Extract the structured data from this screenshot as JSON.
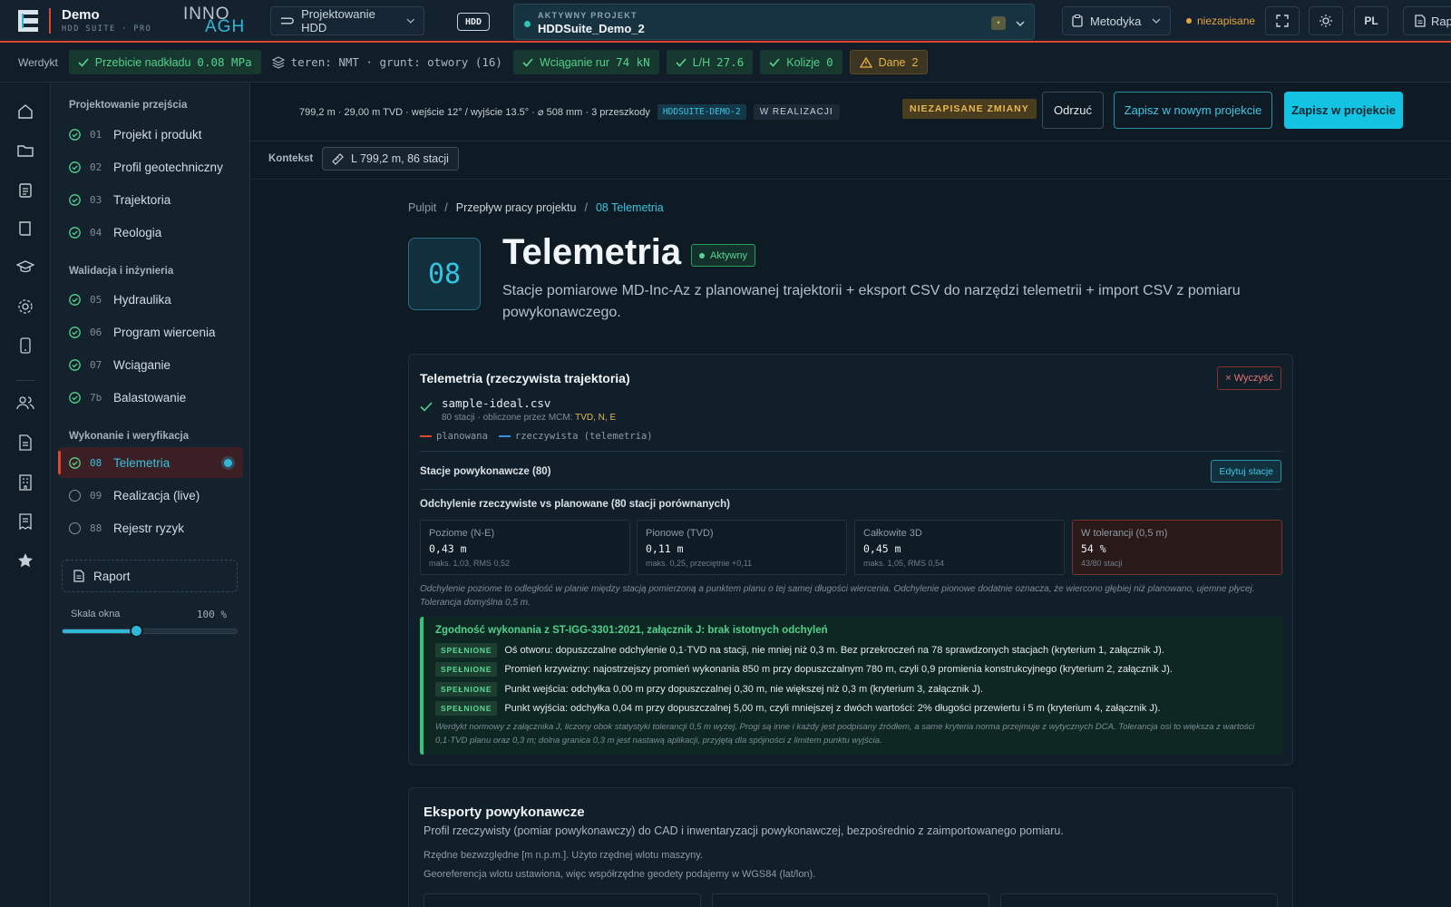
{
  "app": {
    "name": "Demo",
    "subtitle": "HDD SUITE · PRO",
    "partner_logo_text": "INNO AGH",
    "module_selector": "Projektowanie HDD",
    "mode_badge": "HDD",
    "active_project_label": "AKTYWNY PROJEKT",
    "active_project_name": "HDDSuite_Demo_2",
    "methodology": "Metodyka",
    "unsaved_indicator": "niezapisane",
    "language": "PL",
    "report_button_partial": "Rap"
  },
  "verdict": {
    "label": "Werdykt",
    "chips": [
      {
        "status": "ok",
        "text": "Przebicie nadkładu",
        "value": "0.08 MPa"
      },
      {
        "status": "info",
        "text": "teren: NMT · grunt: otwory (16)"
      },
      {
        "status": "ok",
        "text": "Wciąganie rur",
        "value": "74 kN"
      },
      {
        "status": "ok",
        "text": "L/H",
        "value": "27.6"
      },
      {
        "status": "ok",
        "text": "Kolizje",
        "value": "0"
      },
      {
        "status": "warn",
        "text": "Dane",
        "value": "2"
      }
    ]
  },
  "sidebar": {
    "sections": [
      {
        "title": "Projektowanie przejścia",
        "items": [
          {
            "num": "01",
            "label": "Projekt i produkt",
            "state": "done"
          },
          {
            "num": "02",
            "label": "Profil geotechniczny",
            "state": "done"
          },
          {
            "num": "03",
            "label": "Trajektoria",
            "state": "done"
          },
          {
            "num": "04",
            "label": "Reologia",
            "state": "done"
          }
        ]
      },
      {
        "title": "Walidacja i inżynieria",
        "items": [
          {
            "num": "05",
            "label": "Hydraulika",
            "state": "done"
          },
          {
            "num": "06",
            "label": "Program wiercenia",
            "state": "done"
          },
          {
            "num": "07",
            "label": "Wciąganie",
            "state": "done"
          },
          {
            "num": "7b",
            "label": "Balastowanie",
            "state": "done"
          }
        ]
      },
      {
        "title": "Wykonanie i weryfikacja",
        "items": [
          {
            "num": "08",
            "label": "Telemetria",
            "state": "active"
          },
          {
            "num": "09",
            "label": "Realizacja (live)",
            "state": "todo"
          },
          {
            "num": "88",
            "label": "Rejestr ryzyk",
            "state": "todo"
          }
        ]
      }
    ],
    "report": "Raport",
    "scale_label": "Skala okna",
    "scale_value": "100 %",
    "scale_fraction": 0.42
  },
  "header": {
    "summary": "799,2 m · 29,00 m TVD · wejście 12° / wyjście 13.5° · ⌀ 508 mm · 3 przeszkody",
    "project_code": "HDDSUITE-DEMO-2",
    "project_status": "W REALIZACJI",
    "unsaved_changes": "NIEZAPISANE ZMIANY",
    "discard": "Odrzuć",
    "save_new": "Zapisz w nowym projekcie",
    "save": "Zapisz w projekcie"
  },
  "context": {
    "label": "Kontekst",
    "chip": "L 799,2 m, 86 stacji"
  },
  "breadcrumb": [
    "Pulpit",
    "Przepływ pracy projektu",
    "08 Telemetria"
  ],
  "page": {
    "number": "08",
    "title": "Telemetria",
    "status": "Aktywny",
    "description": "Stacje pomiarowe MD-Inc-Az z planowanej trajektorii + eksport CSV do narzędzi telemetrii + import CSV z pomiaru powykonawczego."
  },
  "telemetry": {
    "title": "Telemetria (rzeczywista trajektoria)",
    "clear": "× Wyczyść",
    "file_name": "sample-ideal.csv",
    "file_meta": "80 stacji · obliczone przez MCM:",
    "file_meta_fields": "TVD, N, E",
    "legend_planned": "planowana",
    "legend_actual": "rzeczywista (telemetria)",
    "stations_title": "Stacje powykonawcze (80)",
    "edit_stations": "Edytuj stacje",
    "deviation_title": "Odchylenie rzeczywiste vs planowane (80 stacji porównanych)",
    "stats": [
      {
        "title": "Poziome (N-E)",
        "value": "0,43 m",
        "sub": "maks. 1,03, RMS 0,52"
      },
      {
        "title": "Pionowe (TVD)",
        "value": "0,11 m",
        "sub": "maks. 0,25, przeciętnie +0,11"
      },
      {
        "title": "Całkowite 3D",
        "value": "0,45 m",
        "sub": "maks. 1,05, RMS 0,54"
      },
      {
        "title": "W tolerancji (0,5 m)",
        "value": "54 %",
        "sub": "43/80 stacji"
      }
    ],
    "note": "Odchylenie poziome to odległość w planie między stacją pomierzoną a punktem planu o tej samej długości wiercenia. Odchylenie pionowe dodatnie oznacza, że wiercono głębiej niż planowano, ujemne płycej. Tolerancja domyślna 0,5 m.",
    "compliance_title": "Zgodność wykonania z ST-IGG-3301:2021, załącznik J: brak istotnych odchyleń",
    "criteria_badge": "SPEŁNIONE",
    "criteria": [
      "Oś otworu: dopuszczalne odchylenie 0,1·TVD na stacji, nie mniej niż 0,3 m. Bez przekroczeń na 78 sprawdzonych stacjach (kryterium 1, załącznik J).",
      "Promień krzywizny: najostrzejszy promień wykonania 850 m przy dopuszczalnym 780 m, czyli 0,9 promienia konstrukcyjnego (kryterium 2, załącznik J).",
      "Punkt wejścia: odchyłka 0,00 m przy dopuszczalnej 0,30 m, nie większej niż 0,3 m (kryterium 3, załącznik J).",
      "Punkt wyjścia: odchyłka 0,04 m przy dopuszczalnej 5,00 m, czyli mniejszej z dwóch wartości: 2% długości przewiertu i 5 m (kryterium 4, załącznik J)."
    ],
    "compliance_note": "Werdykt normowy z załącznika J, liczony obok statystyki tolerancji 0,5 m wyżej. Progi są inne i każdy jest podpisany źródłem, a same kryteria norma przejmuje z wytycznych DCA. Tolerancja osi to większa z wartości 0,1·TVD planu oraz 0,3 m; dolna granica 0,3 m jest nastawą aplikacji, przyjętą dla spójności z limitem punktu wyjścia."
  },
  "exports": {
    "title": "Eksporty powykonawcze",
    "subtitle": "Profil rzeczywisty (pomiar powykonawczy) do CAD i inwentaryzacji powykonawczej, bezpośrednio z zaimportowanego pomiaru.",
    "line1": "Rzędne bezwzględne [m n.p.m.]. Użyto rzędnej wlotu maszyny.",
    "line2": "Georeferencja wlotu ustawiona, więc współrzędne geodety podajemy w WGS84 (lat/lon)."
  },
  "colors": {
    "accent": "#14c2e2",
    "danger": "#e0452e",
    "ok": "#54d18b",
    "warn": "#e8b34a",
    "planned_line": "#e0452e",
    "actual_line": "#3a8fd8"
  }
}
